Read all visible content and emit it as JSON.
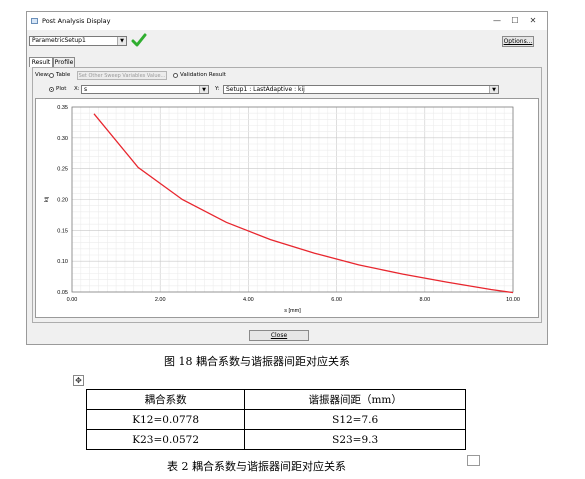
{
  "window": {
    "title": "Post Analysis Display",
    "minimize": "—",
    "maximize": "☐",
    "close": "✕"
  },
  "toolbar": {
    "setup_value": "ParametricSetup1",
    "options_label": "Options..."
  },
  "tabs": [
    {
      "label": "Result"
    },
    {
      "label": "Profile"
    }
  ],
  "view": {
    "label": "View:",
    "table_label": "Table",
    "sweep_button": "Set Other Sweep Variables Value...",
    "validation_label": "Validation Result",
    "plot_label": "Plot",
    "x_label": "X:",
    "x_value": "s",
    "y_label": "Y:",
    "y_value": "Setup1 : LastAdaptive : kij"
  },
  "close_label": "Close",
  "figure_caption": "图 18  耦合系数与谐振器间距对应关系",
  "table_caption": "表 2  耦合系数与谐振器间距对应关系",
  "table": {
    "header": [
      "耦合系数",
      "谐振器间距（mm）"
    ],
    "rows": [
      [
        "K12=0.0778",
        "S12=7.6"
      ],
      [
        "K23=0.0572",
        "S23=9.3"
      ]
    ]
  },
  "chart_data": {
    "type": "line",
    "xlabel": "s [mm]",
    "ylabel": "kij",
    "xlim": [
      0,
      10
    ],
    "ylim": [
      0.05,
      0.35
    ],
    "xticks": [
      "0.00",
      "2.00",
      "4.00",
      "6.00",
      "8.00",
      "10.00"
    ],
    "yticks": [
      "0.05",
      "0.10",
      "0.15",
      "0.20",
      "0.25",
      "0.30",
      "0.35"
    ],
    "grid": true,
    "series": [
      {
        "color": "#e8262e",
        "x": [
          0.5,
          1.5,
          2.5,
          3.5,
          4.5,
          5.5,
          6.5,
          7.5,
          8.5,
          9.5,
          10.0
        ],
        "y": [
          0.339,
          0.252,
          0.2,
          0.163,
          0.135,
          0.113,
          0.094,
          0.079,
          0.066,
          0.054,
          0.049
        ]
      }
    ]
  }
}
